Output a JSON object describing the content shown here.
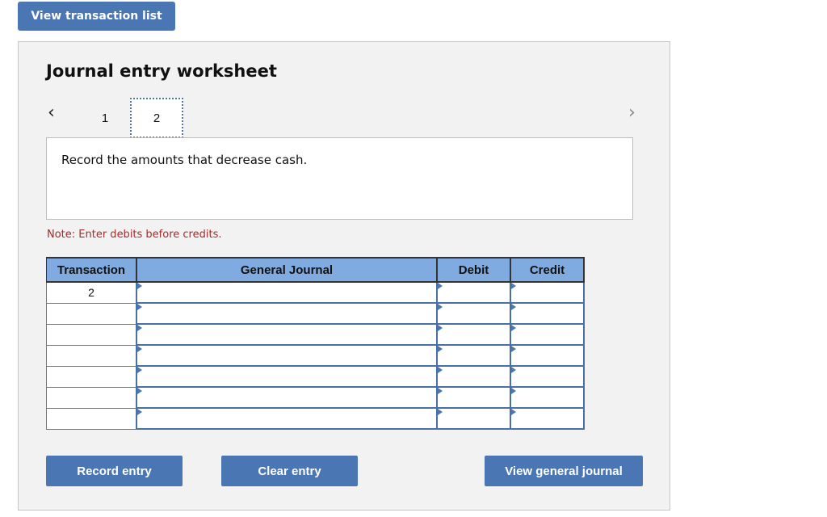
{
  "header": {
    "view_transaction_list_label": "View transaction list"
  },
  "worksheet": {
    "title": "Journal entry worksheet",
    "nav": {
      "prev_icon": "chevron-left-icon",
      "next_icon": "chevron-right-icon",
      "prev_glyph": "‹",
      "next_glyph": "›"
    },
    "tabs": [
      {
        "label": "1",
        "active": false
      },
      {
        "label": "2",
        "active": true
      }
    ],
    "instruction": "Record the amounts that decrease cash.",
    "note": "Note: Enter debits before credits.",
    "table": {
      "columns": [
        "Transaction",
        "General Journal",
        "Debit",
        "Credit"
      ],
      "rows": [
        {
          "transaction": "2",
          "account": "",
          "debit": "",
          "credit": ""
        },
        {
          "transaction": "",
          "account": "",
          "debit": "",
          "credit": ""
        },
        {
          "transaction": "",
          "account": "",
          "debit": "",
          "credit": ""
        },
        {
          "transaction": "",
          "account": "",
          "debit": "",
          "credit": ""
        },
        {
          "transaction": "",
          "account": "",
          "debit": "",
          "credit": ""
        },
        {
          "transaction": "",
          "account": "",
          "debit": "",
          "credit": ""
        },
        {
          "transaction": "",
          "account": "",
          "debit": "",
          "credit": ""
        }
      ]
    },
    "buttons": {
      "record": "Record entry",
      "clear": "Clear entry",
      "view_journal": "View general journal"
    }
  },
  "colors": {
    "accent": "#4a77b4",
    "header_bg": "#80abe0",
    "note": "#a52a2a",
    "panel_bg": "#f2f2f2"
  }
}
